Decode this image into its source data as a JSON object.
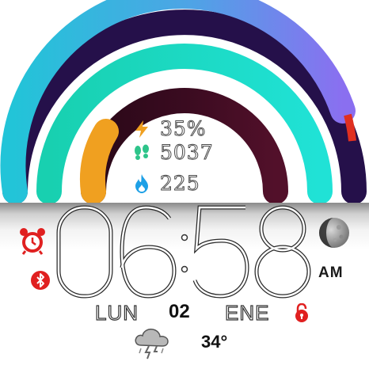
{
  "watch": {
    "stats": {
      "battery": {
        "value": "35%",
        "icon": "lightning-icon",
        "color": "#f0a020"
      },
      "steps": {
        "value": "5037",
        "icon": "footprints-icon",
        "color": "#2ec48a"
      },
      "calories": {
        "value": "225",
        "icon": "flame-icon",
        "color": "#1ea0e6"
      }
    },
    "time": {
      "hour": "06",
      "minute": "58",
      "ampm": "AM"
    },
    "date": {
      "weekday": "LUN",
      "day": "02",
      "month": "ENE"
    },
    "weather": {
      "temperature": "34°",
      "icon": "thunderstorm-cloud-icon"
    },
    "indicators": {
      "alarm": "alarm-clock-icon",
      "bluetooth": "bluetooth-icon",
      "lock": "padlock-icon",
      "moon": "moon-phase-icon"
    },
    "arcs": [
      {
        "name": "outer-progress-arc",
        "fill": 0.93
      },
      {
        "name": "middle-progress-arc",
        "fill": 1.0
      },
      {
        "name": "inner-progress-arc",
        "fill": 0.12
      }
    ],
    "colors": {
      "outer_gradient": [
        "#22c4d8",
        "#6e7fe0",
        "#8a6ff0"
      ],
      "outer_track": "#2a1550",
      "outer_track_end": "#e03020",
      "middle_gradient": [
        "#18d0b0",
        "#1fe0d8"
      ],
      "inner_fill": "#f0a020",
      "inner_track": "#3a0a1e"
    }
  }
}
